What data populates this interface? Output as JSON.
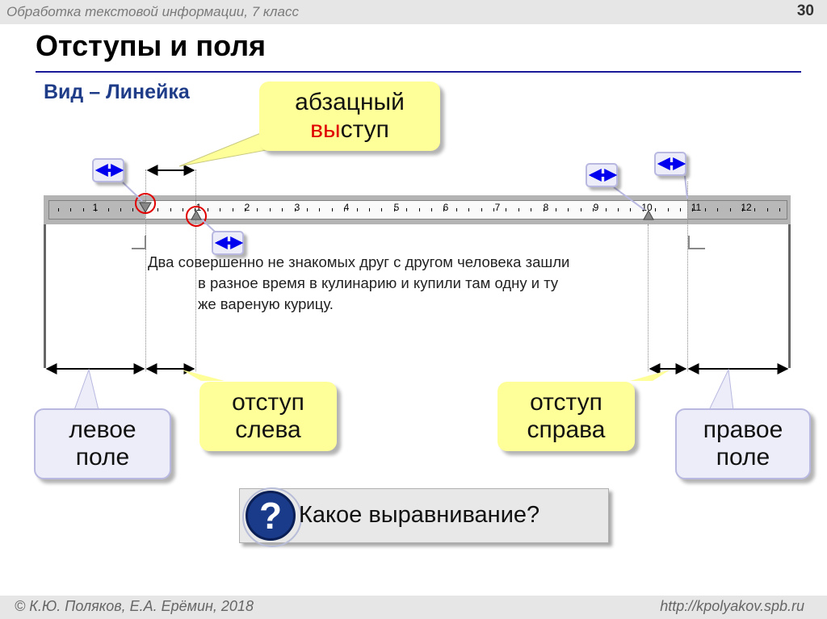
{
  "header": {
    "subject": "Обработка текстовой информации, 7 класс",
    "slide_number": "30"
  },
  "title": "Отступы и поля",
  "subtitle": "Вид – Линейка",
  "ruler": {
    "numbers": [
      "1",
      "1",
      "2",
      "3",
      "4",
      "5",
      "6",
      "7",
      "8",
      "9",
      "10",
      "11",
      "12"
    ]
  },
  "page_text": {
    "line1": "Два совершенно не знакомых друг с другом человека зашли",
    "line2": "в разное время в кулинарию и купили там одну и ту",
    "line3": "же вареную курицу."
  },
  "callouts": {
    "hanging_indent": {
      "line1": "абзацный",
      "line2_red": "вы",
      "line2_rest": "ступ"
    },
    "left_margin": {
      "line1": "левое",
      "line2": "поле"
    },
    "left_indent": {
      "line1": "отступ",
      "line2": "слева"
    },
    "right_indent": {
      "line1": "отступ",
      "line2": "справа"
    },
    "right_margin": {
      "line1": "правое",
      "line2": "поле"
    }
  },
  "question": {
    "mark": "?",
    "text": "Какое выравнивание?"
  },
  "footer": {
    "copyright": "© К.Ю. Поляков, Е.А. Ерёмин, 2018",
    "site": "http://kpolyakov.spb.ru"
  },
  "colors": {
    "callout_yellow": "#ffff99",
    "callout_lavender": "#ecedf8",
    "arrow_blue": "#0000ee",
    "highlight_red": "#e00000",
    "title_rule": "#1a1a99"
  }
}
